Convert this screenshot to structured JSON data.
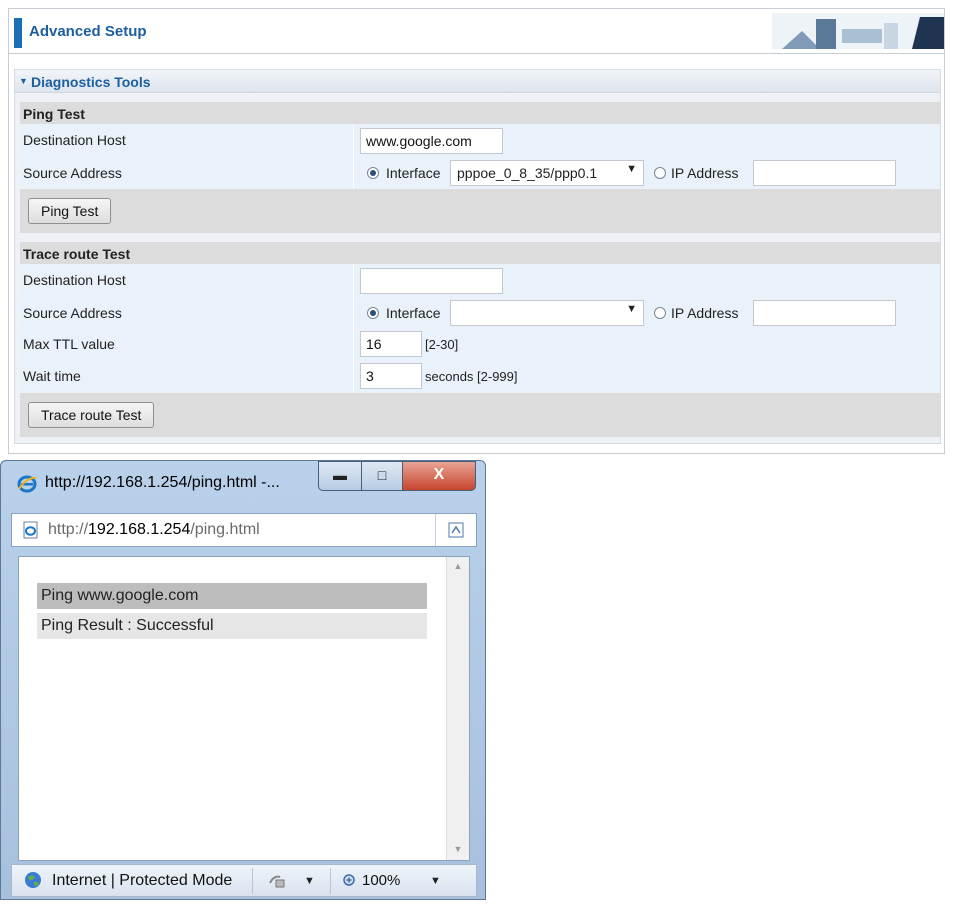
{
  "header": {
    "title": "Advanced Setup"
  },
  "section": {
    "title": "Diagnostics Tools"
  },
  "ping": {
    "heading": "Ping Test",
    "dest_label": "Destination Host",
    "dest_value": "www.google.com",
    "source_label": "Source Address",
    "interface_label": "Interface",
    "interface_value": "pppoe_0_8_35/ppp0.1",
    "ip_label": "IP Address",
    "ip_value": "",
    "button": "Ping Test"
  },
  "trace": {
    "heading": "Trace route Test",
    "dest_label": "Destination Host",
    "dest_value": "",
    "source_label": "Source Address",
    "interface_label": "Interface",
    "interface_value": "",
    "ip_label": "IP Address",
    "ip_value": "",
    "ttl_label": "Max TTL value",
    "ttl_value": "16",
    "ttl_hint": "[2-30]",
    "wait_label": "Wait time",
    "wait_value": "3",
    "wait_hint": "seconds [2-999]",
    "button": "Trace route Test"
  },
  "popup": {
    "title": "http://192.168.1.254/ping.html -...",
    "url_prefix": "http://",
    "url_host": "192.168.1.254",
    "url_path": "/ping.html",
    "result_line1": "Ping www.google.com",
    "result_line2": "Ping Result : Successful",
    "status_zone": "Internet | Protected Mode",
    "zoom": "100%"
  },
  "colors": {
    "accent": "#1c6fb6",
    "row_alt": "#e9f1fb",
    "row_header": "#dcdcdc"
  }
}
